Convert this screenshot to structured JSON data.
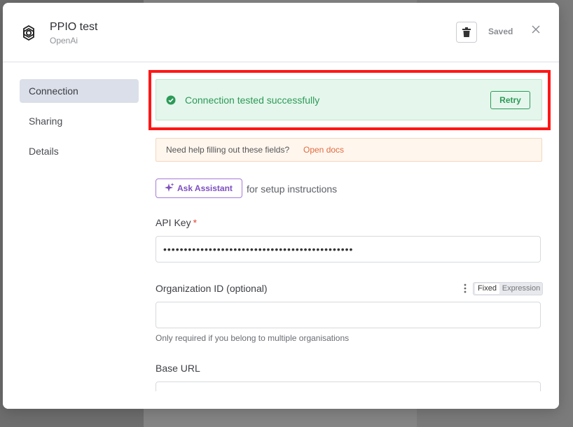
{
  "modal": {
    "title": "PPIO test",
    "subtitle": "OpenAi",
    "saved_label": "Saved"
  },
  "sidebar": {
    "items": [
      {
        "label": "Connection",
        "active": true
      },
      {
        "label": "Sharing",
        "active": false
      },
      {
        "label": "Details",
        "active": false
      }
    ]
  },
  "success": {
    "message": "Connection tested successfully",
    "retry_label": "Retry"
  },
  "docs": {
    "text": "Need help filling out these fields?",
    "link": "Open docs"
  },
  "assistant": {
    "button_label": "Ask Assistant",
    "after_text": "for setup instructions"
  },
  "fields": {
    "api_key": {
      "label": "API Key",
      "required_mark": "*",
      "value": "••••••••••••••••••••••••••••••••••••••••••••••"
    },
    "organization_id": {
      "label": "Organization ID (optional)",
      "toggle_fixed": "Fixed",
      "toggle_expression": "Expression",
      "hint": "Only required if you belong to multiple organisations"
    },
    "base_url": {
      "label": "Base URL"
    }
  },
  "colors": {
    "success": "#2c9a58",
    "docs_link": "#e06b3f",
    "highlight": "#ff1616",
    "assistant": "#7d4fbf"
  }
}
